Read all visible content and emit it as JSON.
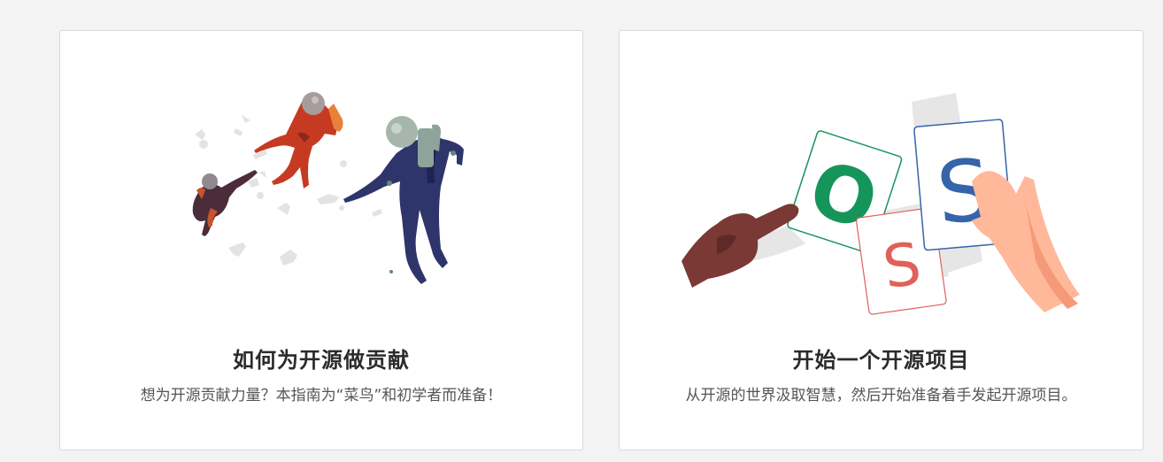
{
  "colors": {
    "page_background": "#f3f3f3",
    "card_background": "#ffffff",
    "card_border": "#d9d9d9",
    "title": "#2b2b2b",
    "description": "#555555",
    "astronaut_red": "#c63a22",
    "astronaut_navy": "#2e356b",
    "letter_o_green": "#16955a",
    "letter_s_red": "#e0605a",
    "letter_s_blue": "#3564aa",
    "hand_skin_dark": "#7a3935",
    "hand_skin_light": "#ffb89a"
  },
  "cards": [
    {
      "illustration": "astronauts-floating-in-space",
      "title": "如何为开源做贡献",
      "description": "想为开源贡献力量？本指南为“菜鸟”和初学者而准备！"
    },
    {
      "illustration": "hands-holding-oss-cards",
      "title": "开始一个开源项目",
      "description": "从开源的世界汲取智慧，然后开始准备着手发起开源项目。",
      "cards_letters": [
        "O",
        "S",
        "S"
      ]
    }
  ]
}
